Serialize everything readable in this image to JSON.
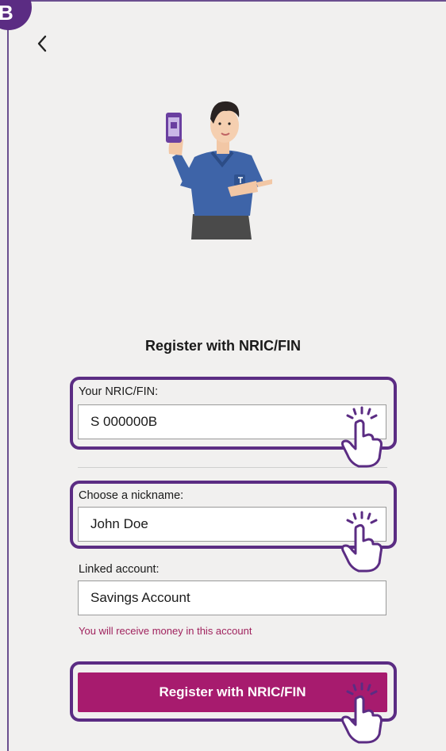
{
  "step": {
    "label": "B"
  },
  "nav": {
    "back_icon": "chevron-left-icon"
  },
  "illustration": {
    "name": "man-holding-phone-illustration"
  },
  "form": {
    "title": "Register with NRIC/FIN",
    "nric": {
      "label": "Your NRIC/FIN:",
      "value": "S 000000B"
    },
    "nickname": {
      "label": "Choose a nickname:",
      "value": "John Doe"
    },
    "account": {
      "label": "Linked account:",
      "value": "Savings Account",
      "hint": "You will receive money in this account"
    },
    "submit_label": "Register with NRIC/FIN"
  },
  "colors": {
    "accent_purple": "#5b2c83",
    "button_magenta": "#a71b6e",
    "hint_text": "#a0235e",
    "background": "#f1f0ef"
  }
}
